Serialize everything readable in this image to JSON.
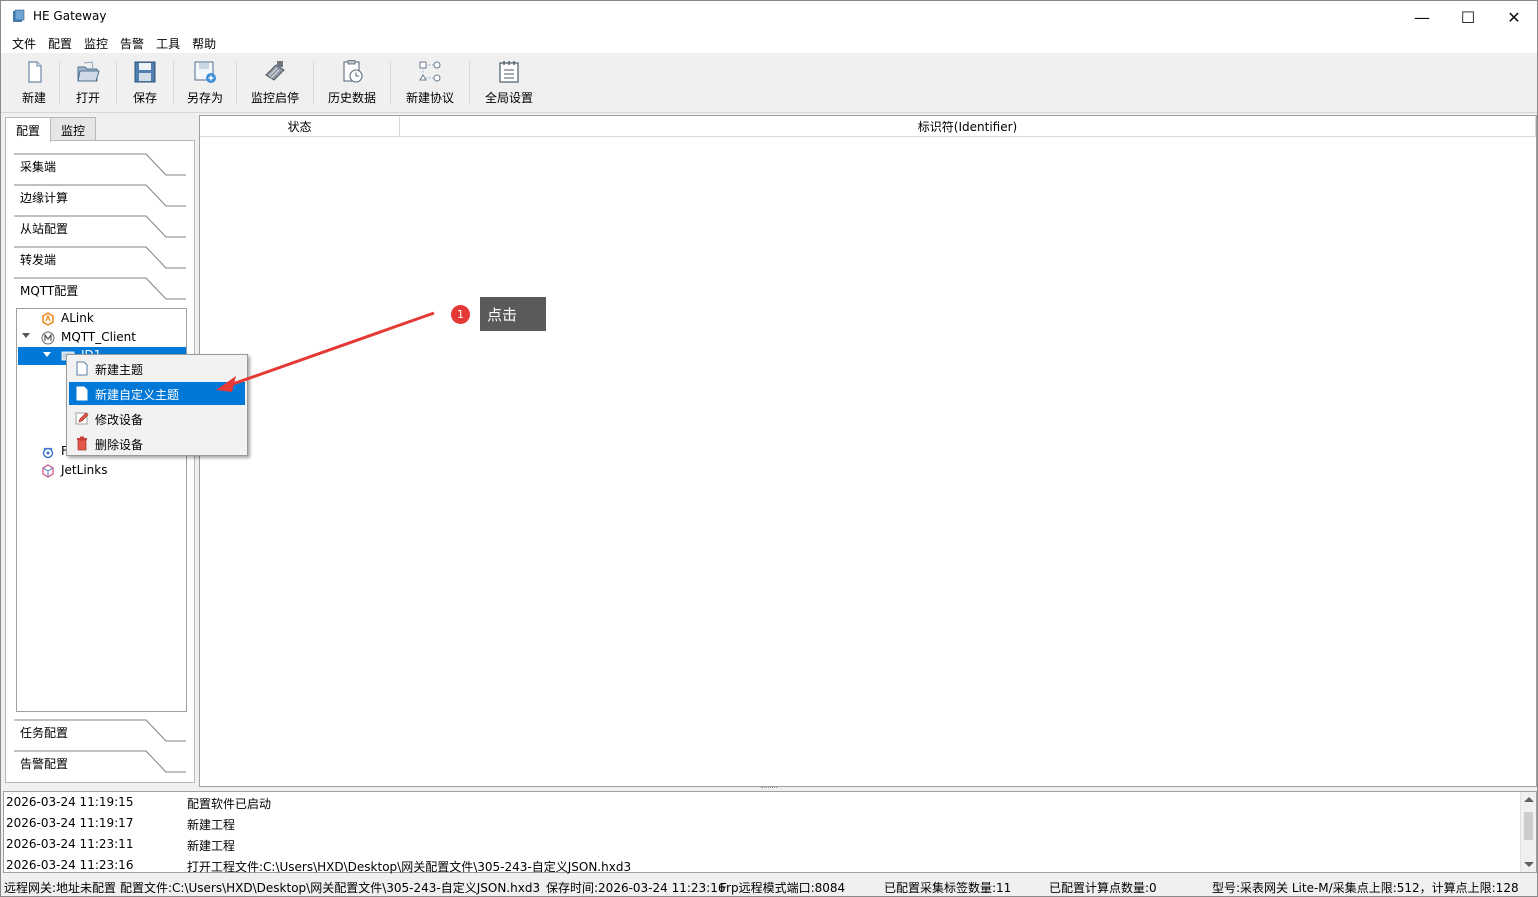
{
  "window": {
    "title": "HE Gateway",
    "controls": {
      "minimize": "—",
      "maximize": "☐",
      "close": "✕"
    }
  },
  "menubar": [
    "文件",
    "配置",
    "监控",
    "告警",
    "工具",
    "帮助"
  ],
  "toolbar": [
    {
      "label": "新建",
      "icon": "new-file-icon"
    },
    {
      "label": "打开",
      "icon": "open-folder-icon"
    },
    {
      "label": "保存",
      "icon": "save-icon"
    },
    {
      "label": "另存为",
      "icon": "save-as-icon"
    },
    {
      "label": "监控启停",
      "icon": "monitor-toggle-icon"
    },
    {
      "label": "历史数据",
      "icon": "history-data-icon"
    },
    {
      "label": "新建协议",
      "icon": "new-protocol-icon"
    },
    {
      "label": "全局设置",
      "icon": "global-settings-icon"
    }
  ],
  "left_tabs": [
    {
      "label": "配置",
      "active": true
    },
    {
      "label": "监控",
      "active": false
    }
  ],
  "accordion": {
    "top": [
      "采集端",
      "边缘计算",
      "从站配置",
      "转发端",
      "MQTT配置"
    ],
    "bottom": [
      "任务配置",
      "告警配置"
    ]
  },
  "tree": {
    "alink": "ALink",
    "mqtt_client": "MQTT_Client",
    "id1": "ID1",
    "fa": "Fa",
    "jetlinks": "JetLinks"
  },
  "context_menu": [
    {
      "label": "新建主题",
      "icon": "new-topic-icon",
      "highlighted": false
    },
    {
      "label": "新建自定义主题",
      "icon": "new-custom-topic-icon",
      "highlighted": true
    },
    {
      "label": "修改设备",
      "icon": "edit-pencil-icon",
      "highlighted": false
    },
    {
      "label": "删除设备",
      "icon": "trash-icon",
      "highlighted": false
    }
  ],
  "grid": {
    "columns": [
      "状态",
      "标识符(Identifier)"
    ]
  },
  "log": [
    {
      "time": "2026-03-24 11:19:15",
      "msg": "配置软件已启动"
    },
    {
      "time": "2026-03-24 11:19:17",
      "msg": "新建工程"
    },
    {
      "time": "2026-03-24 11:23:11",
      "msg": "新建工程"
    },
    {
      "time": "2026-03-24 11:23:16",
      "msg": "打开工程文件:C:\\Users\\HXD\\Desktop\\网关配置文件\\305-243-自定义JSON.hxd3"
    }
  ],
  "statusbar": {
    "remote": "远程网关:地址未配置",
    "config_file": "配置文件:C:\\Users\\HXD\\Desktop\\网关配置文件\\305-243-自定义JSON.hxd3",
    "save_time": "保存时间:2026-03-24 11:23:16",
    "frp": "Frp远程模式端口:8084",
    "tags": "已配置采集标签数量:11",
    "calc": "已配置计算点数量:0",
    "model": "型号:采表网关 Lite-M/采集点上限:512，计算点上限:128"
  },
  "annotation": {
    "step": "1",
    "text": "点击"
  },
  "colors": {
    "selection": "#0078d7",
    "badge": "#e53935",
    "arrow": "#e53935",
    "callout": "#5a5a5a"
  }
}
